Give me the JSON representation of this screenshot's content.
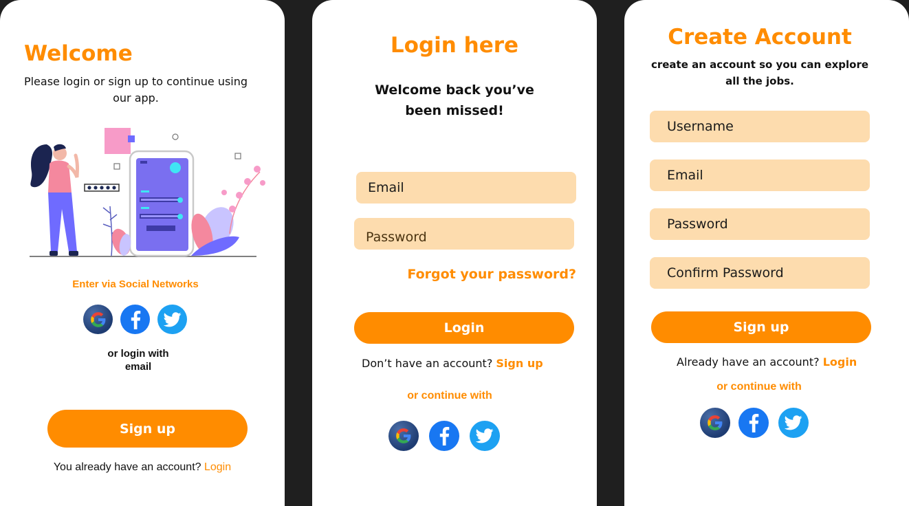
{
  "colors": {
    "accent": "#ff8c00",
    "field_bg": "#fddcae",
    "background": "#1f1f1f",
    "card": "#ffffff"
  },
  "welcome": {
    "title": "Welcome",
    "subtitle": "Please login or sign up to continue using our app.",
    "social_heading": "Enter via Social Networks",
    "or_login_line1": "or login with",
    "or_login_line2": "email",
    "signup_button": "Sign up",
    "have_account_text": "You already have an account?",
    "login_link": "Login",
    "illustration_icon": "person-with-phone-illustration"
  },
  "login": {
    "title": "Login here",
    "subtitle_line1": "Welcome back you’ve",
    "subtitle_line2": "been missed!",
    "email_placeholder": "Email",
    "password_placeholder": "Password",
    "forgot_link": "Forgot your password?",
    "login_button": "Login",
    "no_account_text": "Don’t have an account?",
    "signup_link": "Sign up",
    "continue_with": "or continue with"
  },
  "create": {
    "title": "Create Account",
    "subtitle": "create an account so you can explore all the jobs.",
    "username_placeholder": "Username",
    "email_placeholder": "Email",
    "password_placeholder": "Password",
    "confirm_placeholder": "Confirm Password",
    "signup_button": "Sign up",
    "have_account_text": "Already have an account?",
    "login_link": "Login",
    "continue_with": "or continue with"
  },
  "icons": [
    "google-icon",
    "facebook-icon",
    "twitter-icon"
  ]
}
